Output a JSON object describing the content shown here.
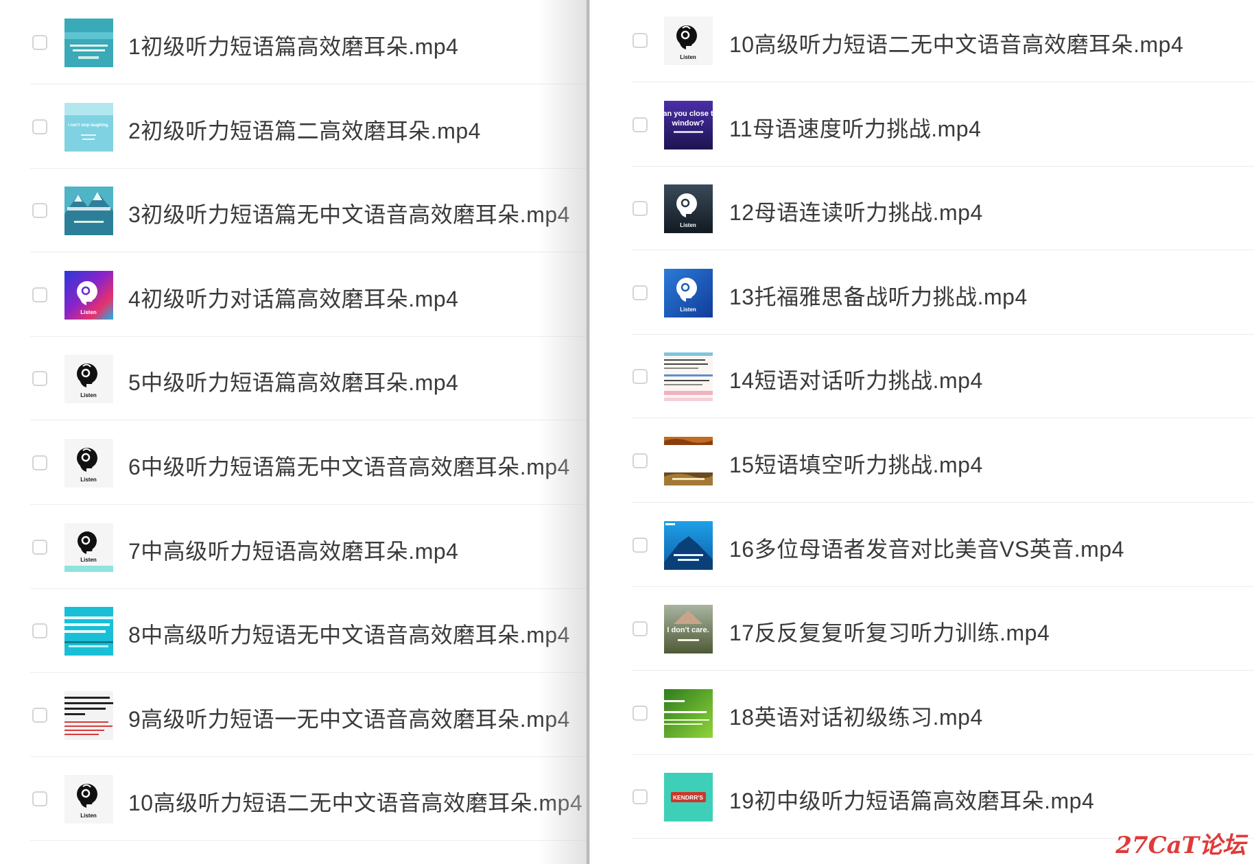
{
  "left_files": [
    {
      "name": "1初级听力短语篇高效磨耳朵.mp4",
      "thumb": "teal-text"
    },
    {
      "name": "2初级听力短语篇二高效磨耳朵.mp4",
      "thumb": "light-teal-text"
    },
    {
      "name": "3初级听力短语篇无中文语音高效磨耳朵.mp4",
      "thumb": "mountain-teal"
    },
    {
      "name": "4初级听力对话篇高效磨耳朵.mp4",
      "thumb": "colorful-listen"
    },
    {
      "name": "5中级听力短语篇高效磨耳朵.mp4",
      "thumb": "white-listen"
    },
    {
      "name": "6中级听力短语篇无中文语音高效磨耳朵.mp4",
      "thumb": "white-listen"
    },
    {
      "name": "7中高级听力短语高效磨耳朵.mp4",
      "thumb": "white-listen-teal"
    },
    {
      "name": "8中高级听力短语无中文语音高效磨耳朵.mp4",
      "thumb": "cyan-text"
    },
    {
      "name": "9高级听力短语一无中文语音高效磨耳朵.mp4",
      "thumb": "white-text"
    },
    {
      "name": "10高级听力短语二无中文语音高效磨耳朵.mp4",
      "thumb": "white-listen"
    }
  ],
  "right_files": [
    {
      "name": "10高级听力短语二无中文语音高效磨耳朵.mp4",
      "thumb": "white-listen"
    },
    {
      "name": "11母语速度听力挑战.mp4",
      "thumb": "purple-text"
    },
    {
      "name": "12母语连读听力挑战.mp4",
      "thumb": "dark-listen"
    },
    {
      "name": "13托福雅思备战听力挑战.mp4",
      "thumb": "blue-listen"
    },
    {
      "name": "14短语对话听力挑战.mp4",
      "thumb": "striped-text"
    },
    {
      "name": "15短语填空听力挑战.mp4",
      "thumb": "desert"
    },
    {
      "name": "16多位母语者发音对比美音VS英音.mp4",
      "thumb": "blue-mountain"
    },
    {
      "name": "17反反复复听复习听力训练.mp4",
      "thumb": "dont-care"
    },
    {
      "name": "18英语对话初级练习.mp4",
      "thumb": "green-text"
    },
    {
      "name": "19初中级听力短语篇高效磨耳朵.mp4",
      "thumb": "kendrr"
    }
  ],
  "thumb_texts": {
    "listen": "Listen",
    "dont_care": "I don't care.",
    "kendrr": "KENDRR'S",
    "window": "an you close t window?",
    "cant_stop": "I can't stop laughing."
  },
  "watermark": "27CaT论坛"
}
